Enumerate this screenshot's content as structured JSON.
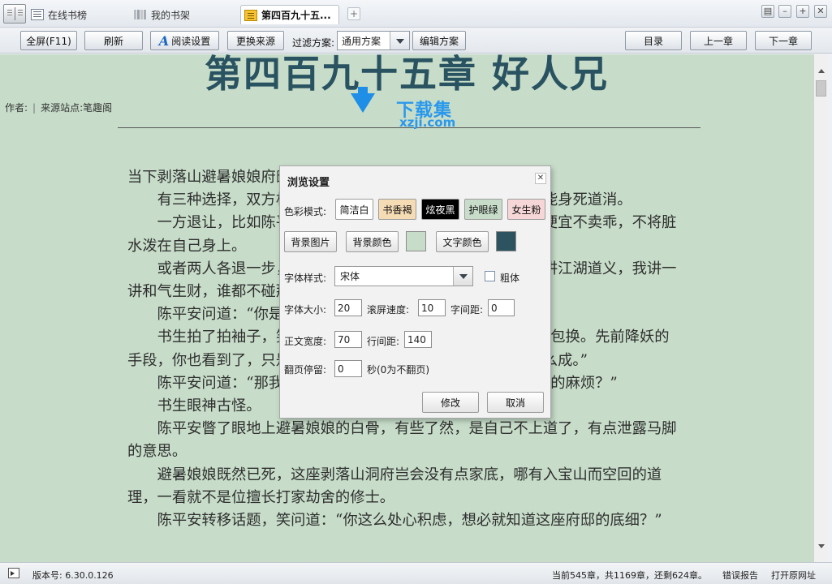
{
  "tabs": {
    "online": "在线书榜",
    "shelf": "我的书架",
    "current": "第四百九十五..."
  },
  "toolbar": {
    "fullscreen": "全屏(F11)",
    "refresh": "刷新",
    "read_settings": "阅读设置",
    "change_source": "更换来源",
    "filter_label": "过滤方案:",
    "filter_value": "通用方案",
    "edit_filter": "编辑方案",
    "toc": "目录",
    "prev_chapter": "上一章",
    "next_chapter": "下一章"
  },
  "chapter": {
    "title": "第四百九十五章 好人兄",
    "author_label": "作者:",
    "source_label": "来源站点:笔趣阁"
  },
  "content": [
    "当下剥落山避暑娘娘府邸门外，就像一局一方各居一侧的棋局。",
    "有三种选择，双方相互厮杀，只是谁厮杀，谁退让，极有可能身死道消。",
    "一方退让，比如陈平安带着五头妖物离去，或是那书生得了便宜不卖乖，不将脏水泼在自己身上。",
    "或者两人各退一步，平分这座洞府里的宝物，所谓的你讲一讲江湖道义，我讲一讲和气生财，谁都不碰那五头妖物。",
    "陈平安问道：“你是？”",
    "书生拍了拍袖子，笑道：“我是个书生，一身浩然正气，如假包换。先前降妖的手段，你也看到了，只是担心打草惊蛇，没点遮掩身份的手段怎么成。”",
    "陈平安问道：“那我们这就结盟？一起就近去找那位辟尘元君的麻烦？”",
    "书生眼神古怪。",
    "陈平安瞥了眼地上避暑娘娘的白骨，有些了然，是自己不上道了，有点泄露马脚的意思。",
    "避暑娘娘既然已死，这座剥落山洞府岂会没有点家底，哪有入宝山而空回的道理，一看就不是位擅长打家劫舍的修士。",
    "陈平安转移话题，笑问道：“你这么处心积虑，想必就知道这座府邸的底细？”"
  ],
  "watermark": {
    "brand": "下载集",
    "domain": "xzji.com"
  },
  "status": {
    "version": "版本号: 6.30.0.126",
    "progress": "当前545章，共1169章，还剩624章。",
    "report": "错误报告",
    "open_url": "打开原网址"
  },
  "dialog": {
    "title": "浏览设置",
    "color_mode_label": "色彩模式:",
    "modes": [
      {
        "label": "简洁白",
        "bg": "#ffffff",
        "fg": "#111111"
      },
      {
        "label": "书香褐",
        "bg": "#f6dcb4",
        "fg": "#111111"
      },
      {
        "label": "炫夜黑",
        "bg": "#000000",
        "fg": "#ffffff"
      },
      {
        "label": "护眼绿",
        "bg": "#c7ddc9",
        "fg": "#111111"
      },
      {
        "label": "女生粉",
        "bg": "#f6d6d6",
        "fg": "#111111"
      }
    ],
    "bg_image": "背景图片",
    "bg_color": "背景颜色",
    "bg_color_value": "#c7ddc9",
    "text_color": "文字颜色",
    "text_color_value": "#2e5360",
    "font_style_label": "字体样式:",
    "font_style_value": "宋体",
    "bold_label": "粗体",
    "font_size_label": "字体大小:",
    "font_size_value": "20",
    "scroll_speed_label": "滚屏速度:",
    "scroll_speed_value": "10",
    "letter_spacing_label": "字间距:",
    "letter_spacing_value": "0",
    "text_width_label": "正文宽度:",
    "text_width_value": "70",
    "line_spacing_label": "行间距:",
    "line_spacing_value": "140",
    "page_stay_label": "翻页停留:",
    "page_stay_value": "0",
    "page_stay_unit": "秒(0为不翻页)",
    "ok": "修改",
    "cancel": "取消"
  }
}
